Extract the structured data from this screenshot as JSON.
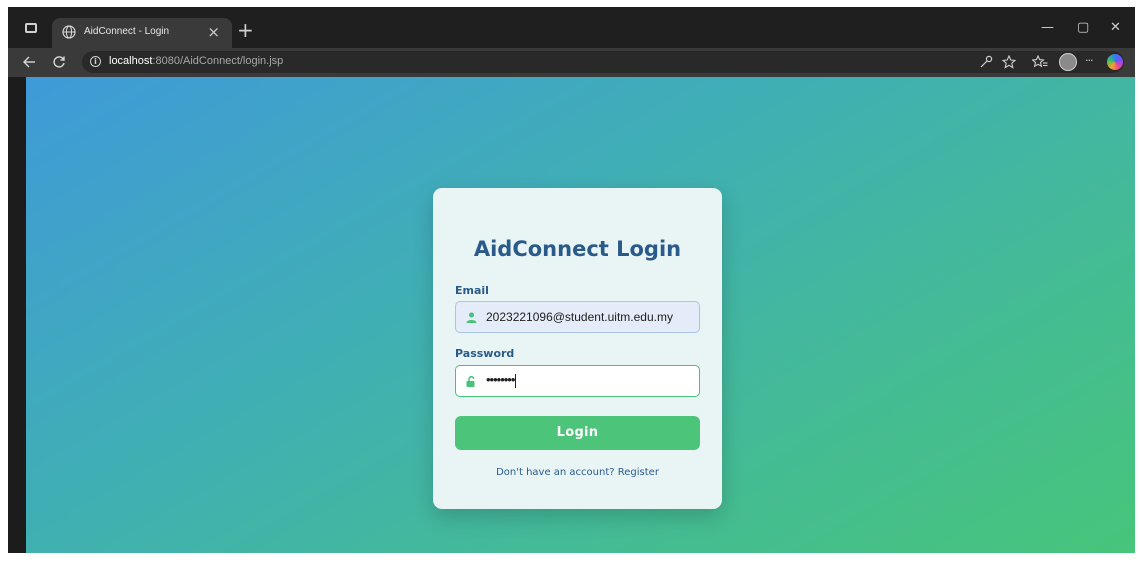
{
  "browser": {
    "tab_title": "AidConnect - Login",
    "tab_close": "×",
    "new_tab": "+",
    "url_host": "localhost",
    "url_path": ":8080/AidConnect/login.jsp",
    "info_glyph": "i",
    "more_glyph": "···",
    "window_controls": {
      "minimize": "—",
      "restore": "▢",
      "close": "✕"
    },
    "icons": [
      "window-icon",
      "globe-icon",
      "back-icon",
      "reload-icon",
      "info-icon",
      "key-icon",
      "star-icon",
      "favorites-icon",
      "profile-icon",
      "more-icon",
      "copilot-icon"
    ]
  },
  "login": {
    "title": "AidConnect Login",
    "email_label": "Email",
    "email_value": "2023221096@student.uitm.edu.my",
    "password_label": "Password",
    "password_value": "••••••••",
    "login_button": "Login",
    "register_text": "Don't have an account? Register"
  },
  "colors": {
    "accent_green": "#4cc47a",
    "title_blue": "#2a5a8a",
    "gradient_start": "#3f9ad8",
    "gradient_end": "#47c57a"
  }
}
